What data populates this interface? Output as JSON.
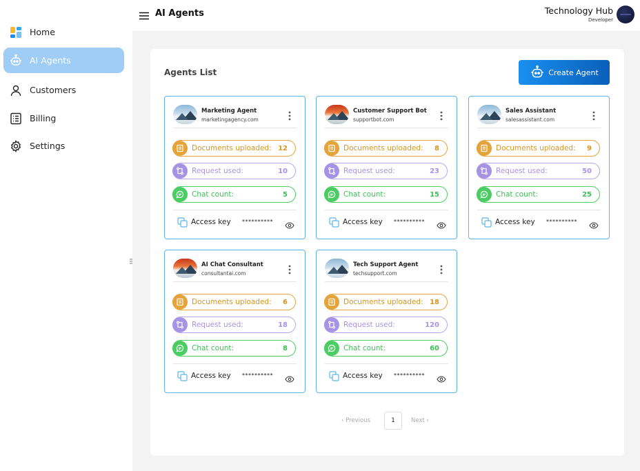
{
  "app": {
    "page_title": "AI Agents"
  },
  "user": {
    "name": "Technology Hub",
    "role": "Developer"
  },
  "sidebar": {
    "items": [
      {
        "label": "Home",
        "icon": "home-grid-icon"
      },
      {
        "label": "AI Agents",
        "icon": "robot-icon",
        "active": true
      },
      {
        "label": "Customers",
        "icon": "user-icon"
      },
      {
        "label": "Billing",
        "icon": "receipt-icon"
      },
      {
        "label": "Settings",
        "icon": "gear-icon"
      }
    ]
  },
  "main": {
    "section_title": "Agents List",
    "create_label": "Create Agent",
    "stat_labels": {
      "docs": "Documents uploaded:",
      "requests": "Request used:",
      "chats": "Chat count:"
    },
    "access_key_label": "Access key",
    "access_key_mask": "**********",
    "agents": [
      {
        "name": "Marketing Agent",
        "domain": "marketingagency.com",
        "docs": "12",
        "requests": "10",
        "chats": "5"
      },
      {
        "name": "Customer Support Bot",
        "domain": "supportbot.com",
        "docs": "8",
        "requests": "23",
        "chats": "15"
      },
      {
        "name": "Sales Assistant",
        "domain": "salesassistant.com",
        "docs": "9",
        "requests": "50",
        "chats": "25"
      },
      {
        "name": "AI Chat Consultant",
        "domain": "consultantai.com",
        "docs": "6",
        "requests": "18",
        "chats": "8"
      },
      {
        "name": "Tech Support Agent",
        "domain": "techsupport.com",
        "docs": "18",
        "requests": "120",
        "chats": "60"
      }
    ]
  },
  "pagination": {
    "prev": "Previous",
    "current": "1",
    "next": "Next"
  },
  "colors": {
    "accent": "#1a8ff0",
    "docs": "#e4a43b",
    "requests": "#a793e6",
    "chats": "#4ccd63",
    "active_nav": "#9fcdf6"
  }
}
